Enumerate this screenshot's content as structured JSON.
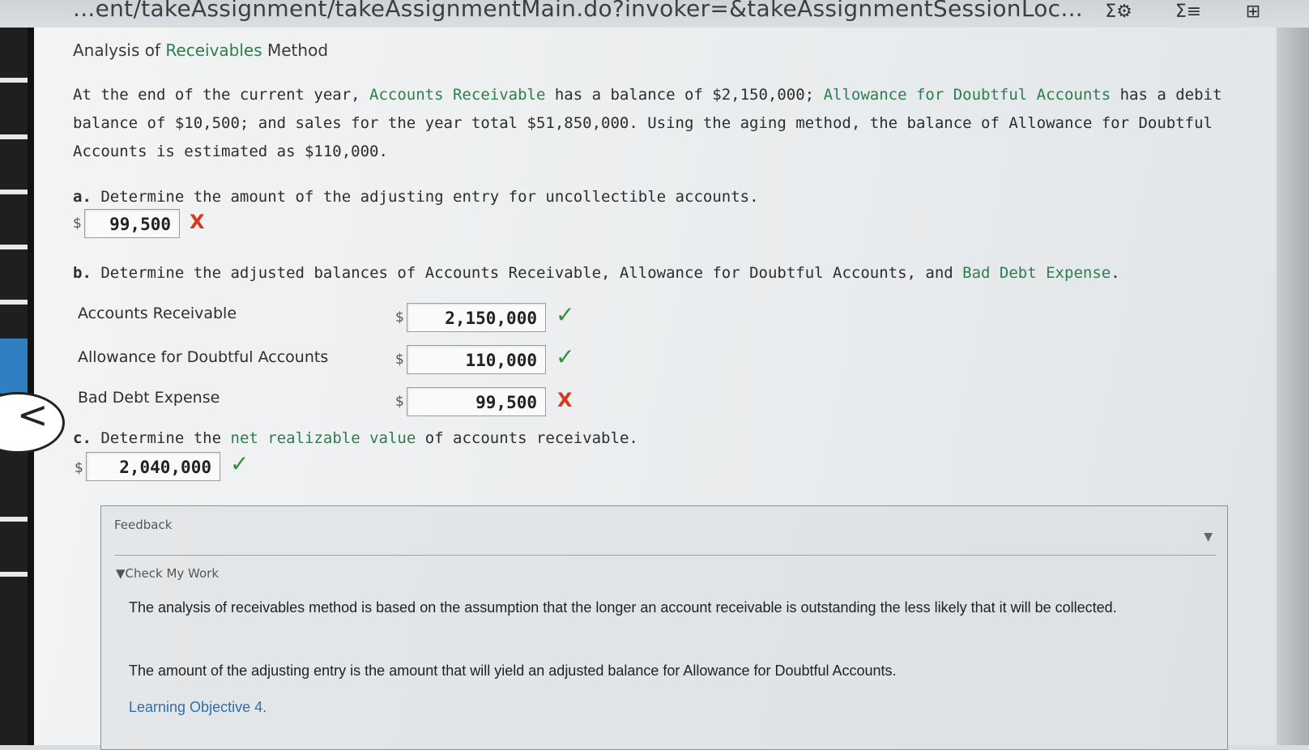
{
  "browser": {
    "url_text": "...ent/takeAssignment/takeAssignmentMain.do?invoker=&takeAssignmentSessionLoc...",
    "icons": [
      "sigma-settings-icon",
      "sigma-list-icon",
      "add-window-icon"
    ]
  },
  "page": {
    "title_prefix": "Analysis of ",
    "title_link": "Receivables",
    "title_suffix": " Method",
    "problem": {
      "t1": "At the end of the current year, ",
      "link1": "Accounts Receivable",
      "t2": " has a balance of $2,150,000; ",
      "link2": "Allowance for Doubtful Accounts",
      "t3": " has a debit balance of $10,500; and sales for the year total $51,850,000. Using the aging method, the balance of Allowance for Doubtful Accounts is estimated as $110,000."
    },
    "part_a": {
      "letter": "a.",
      "text": "Determine the amount of the adjusting entry for uncollectible accounts.",
      "currency": "$",
      "value": "99,500",
      "result": "X"
    },
    "part_b": {
      "letter": "b.",
      "text_pre": "Determine the adjusted balances of Accounts Receivable, Allowance for Doubtful Accounts, and ",
      "link": "Bad Debt Expense",
      "text_post": ".",
      "rows": [
        {
          "label": "Accounts Receivable",
          "currency": "$",
          "value": "2,150,000",
          "result": "✓"
        },
        {
          "label": "Allowance for Doubtful Accounts",
          "currency": "$",
          "value": "110,000",
          "result": "✓"
        },
        {
          "label": "Bad Debt Expense",
          "currency": "$",
          "value": "99,500",
          "result": "X"
        }
      ]
    },
    "part_c": {
      "letter": "c.",
      "text_pre": "Determine the ",
      "link": "net realizable value",
      "text_post": " of accounts receivable.",
      "currency": "$",
      "value": "2,040,000",
      "result": "✓"
    }
  },
  "nav": {
    "back_glyph": "<"
  },
  "feedback": {
    "title": "Feedback",
    "toggle_glyph": "▼",
    "check_label": "▼Check My Work",
    "p1": "The analysis of receivables method is based on the assumption that the longer an account receivable is outstanding the less likely that it will be collected.",
    "p2": "The amount of the adjusting entry is the amount that will yield an adjusted balance for Allowance for Doubtful Accounts.",
    "link": "Learning Objective 4."
  }
}
